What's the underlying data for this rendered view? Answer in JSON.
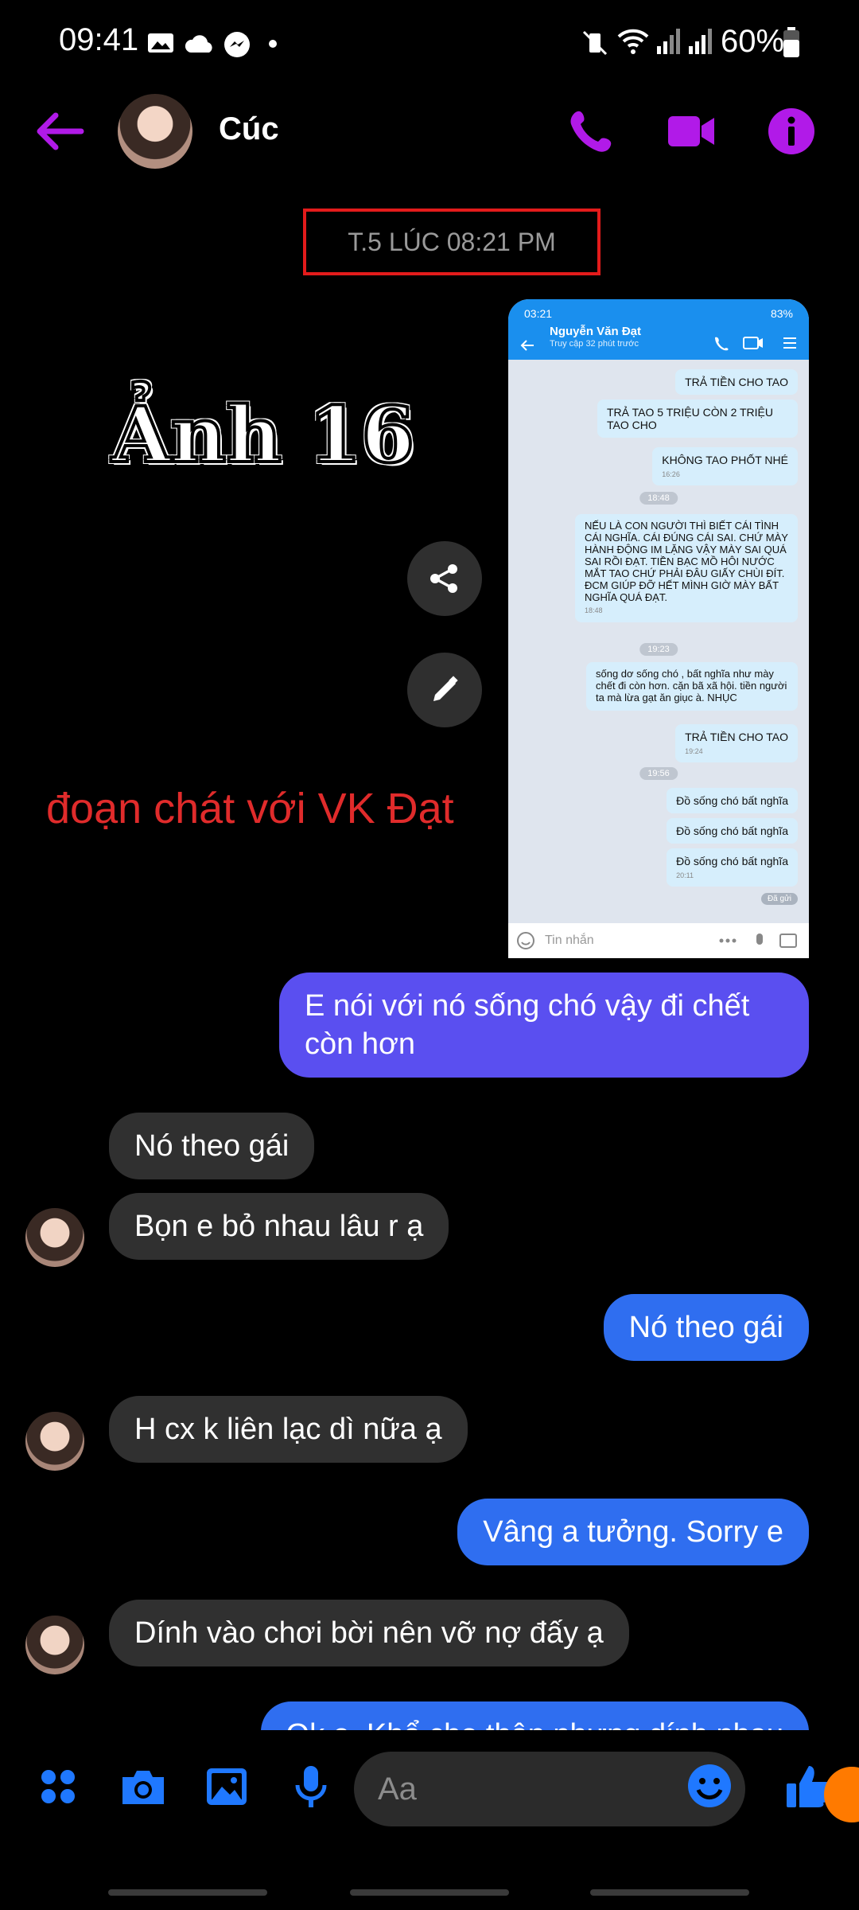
{
  "status": {
    "time": "09:41",
    "battery": "60%"
  },
  "header": {
    "contact_name": "Cúc"
  },
  "timestamp": "T.5 LÚC 08:21 PM",
  "annotations": {
    "image_label": "Ảnh 16",
    "caption": "đoạn chát với VK Đạt"
  },
  "embedded": {
    "status_time": "03:21",
    "battery": "83%",
    "contact": "Nguyễn Văn Đạt",
    "subtitle": "Truy cập 32 phút trước",
    "messages": [
      "TRẢ TIỀN CHO TAO",
      "TRẢ TAO 5 TRIỆU CÒN 2 TRIỆU TAO CHO",
      "KHÔNG TAO PHỐT NHÉ",
      "NẾU LÀ CON NGƯỜI THÌ BIẾT CÁI TÌNH CÁI NGHĨA. CÁI ĐÚNG CÁI SAI. CHỨ MÀY HÀNH ĐỘNG IM LẶNG VẬY MÀY SAI QUÁ SAI RỒI ĐẠT. TIỀN BẠC MỒ HÔI NƯỚC MẮT TAO CHỨ PHẢI ĐÂU GIẤY CHÙI ĐÍT. ĐCM GIÚP ĐỠ HẾT MÌNH GIỜ MÀY BẤT NGHĨA QUÁ ĐẠT.",
      "sống dơ sống chó , bất nghĩa như mày chết đi còn hơn. cặn bã xã hội. tiền người ta mà lừa gạt ăn giục à. NHỤC",
      "TRẢ TIỀN CHO TAO",
      "Đồ sống chó bất nghĩa",
      "Đồ sống chó bất nghĩa",
      "Đồ sống chó bất nghĩa"
    ],
    "times": [
      "16:26",
      "18:48",
      "18:48",
      "19:23",
      "19:24",
      "19:56",
      "20:11"
    ],
    "sent_label": "Đã gửi",
    "input_placeholder": "Tin nhắn"
  },
  "messages": [
    {
      "dir": "out",
      "text": "E nói với nó sống chó vậy đi chết còn hơn"
    },
    {
      "dir": "in",
      "text": "Nó theo gái"
    },
    {
      "dir": "in",
      "text": "Bọn e bỏ nhau lâu r ạ"
    },
    {
      "dir": "out",
      "text": "Nó theo gái"
    },
    {
      "dir": "in",
      "text": "H cx k liên lạc dì nữa ạ"
    },
    {
      "dir": "out",
      "text": "Vâng a tưởng. Sorry e"
    },
    {
      "dir": "in",
      "text": "Dính vào chơi bời nên vỡ nợ đấy ạ"
    },
    {
      "dir": "out",
      "text": "Ok e. Khổ cho thân nhưng dính nhau"
    }
  ],
  "composer": {
    "placeholder": "Aa"
  },
  "colors": {
    "accent": "#b11ae8",
    "blue": "#2f6ef0",
    "bubble_in": "#303030",
    "stamp_border": "#e31b1b"
  }
}
